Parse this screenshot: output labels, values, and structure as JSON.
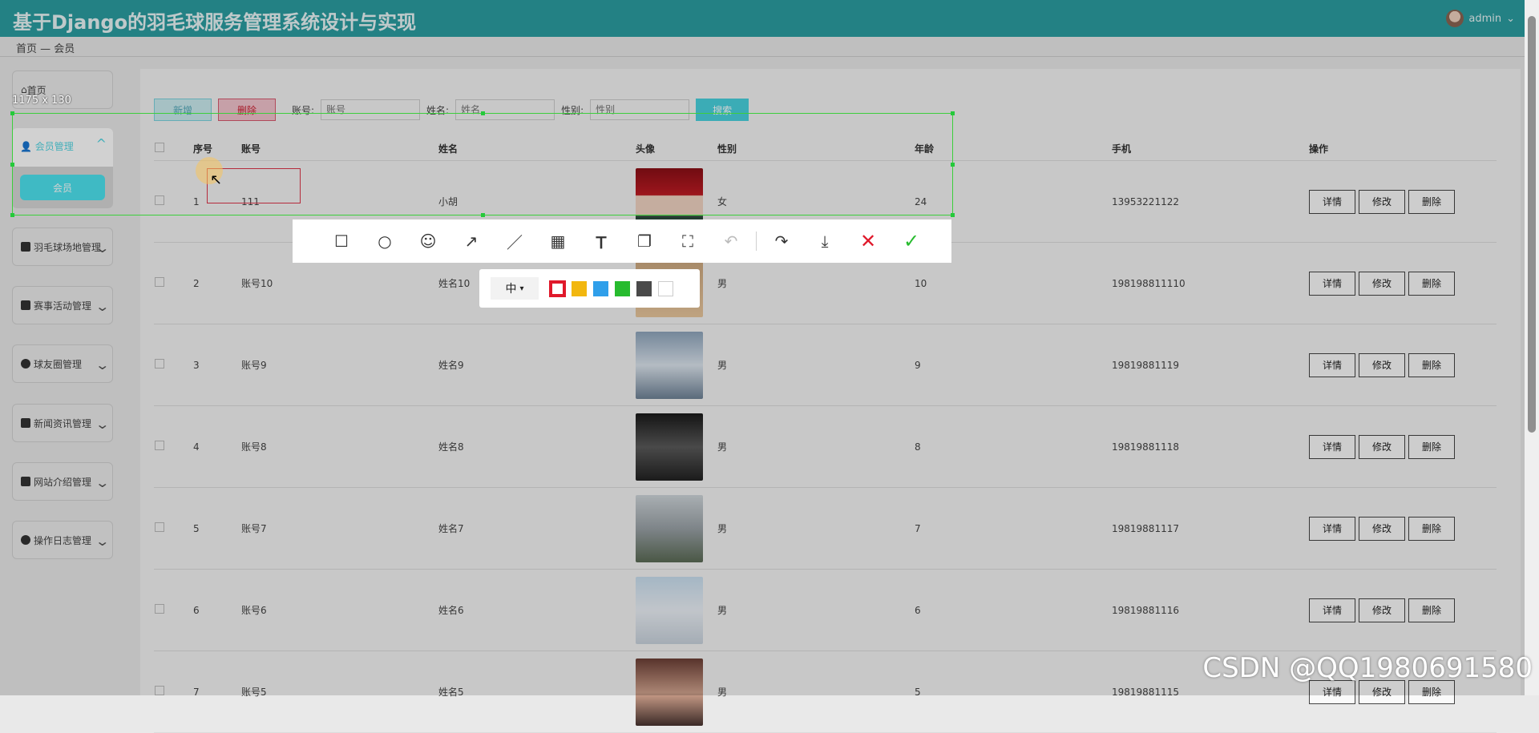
{
  "header": {
    "title": "基于Django的羽毛球服务管理系统设计与实现",
    "user": "admin"
  },
  "breadcrumb": {
    "home": "首页",
    "sep": "—",
    "current": "会员"
  },
  "sidebar": {
    "items": [
      {
        "label": "首页"
      },
      {
        "label": "会员管理",
        "child": "会员"
      },
      {
        "label": "羽毛球场地管理"
      },
      {
        "label": "赛事活动管理"
      },
      {
        "label": "球友圈管理"
      },
      {
        "label": "新闻资讯管理"
      },
      {
        "label": "网站介绍管理"
      },
      {
        "label": "操作日志管理"
      }
    ]
  },
  "toolbar": {
    "add": "新增",
    "delete": "删除",
    "account_label": "账号:",
    "account_placeholder": "账号",
    "name_label": "姓名:",
    "name_placeholder": "姓名",
    "gender_label": "性别:",
    "gender_placeholder": "性别",
    "search": "搜索"
  },
  "table": {
    "headers": [
      "序号",
      "账号",
      "姓名",
      "头像",
      "性别",
      "年龄",
      "手机",
      "操作"
    ],
    "actions": [
      "详情",
      "修改",
      "删除"
    ],
    "rows": [
      {
        "no": "1",
        "account": "111",
        "name": "小胡",
        "gender": "女",
        "age": "24",
        "phone": "13953221122"
      },
      {
        "no": "2",
        "account": "账号10",
        "name": "姓名10",
        "gender": "男",
        "age": "10",
        "phone": "198198811110"
      },
      {
        "no": "3",
        "account": "账号9",
        "name": "姓名9",
        "gender": "男",
        "age": "9",
        "phone": "19819881119"
      },
      {
        "no": "4",
        "account": "账号8",
        "name": "姓名8",
        "gender": "男",
        "age": "8",
        "phone": "19819881118"
      },
      {
        "no": "5",
        "account": "账号7",
        "name": "姓名7",
        "gender": "男",
        "age": "7",
        "phone": "19819881117"
      },
      {
        "no": "6",
        "account": "账号6",
        "name": "姓名6",
        "gender": "男",
        "age": "6",
        "phone": "19819881116"
      },
      {
        "no": "7",
        "account": "账号5",
        "name": "姓名5",
        "gender": "男",
        "age": "5",
        "phone": "19819881115"
      }
    ]
  },
  "screenshot_tool": {
    "selection_size": "1175 x 130",
    "tools": [
      "rectangle-icon",
      "circle-icon",
      "emoji-icon",
      "arrow-icon",
      "pen-icon",
      "mosaic-icon",
      "text-icon",
      "pin-icon",
      "ocr-icon",
      "undo-icon",
      "share-icon",
      "download-icon",
      "cancel-icon",
      "confirm-icon"
    ],
    "size_option": "中",
    "colors": [
      "#e0192b",
      "#f2b70f",
      "#2f9fea",
      "#27bb2e",
      "#4a4a4a",
      "#ffffff"
    ]
  },
  "watermark": "CSDN @QQ1980691580"
}
